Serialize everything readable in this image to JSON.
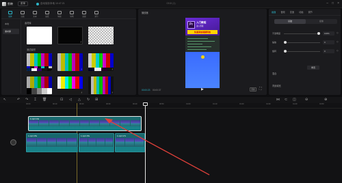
{
  "app": {
    "name": "剪映",
    "menu_label": "菜单",
    "autosave": "自动保存本地 10:47:21",
    "doc_title": "0315 (1)"
  },
  "toolbar": {
    "tools": [
      {
        "label": "媒体",
        "icon": "media-icon",
        "active": true
      },
      {
        "label": "音频",
        "icon": "audio-icon",
        "active": false
      },
      {
        "label": "文本",
        "icon": "text-icon",
        "active": false
      },
      {
        "label": "贴纸",
        "icon": "sticker-icon",
        "active": false
      },
      {
        "label": "特效",
        "icon": "effects-icon",
        "active": false
      },
      {
        "label": "转场",
        "icon": "transition-icon",
        "active": false
      },
      {
        "label": "滤镜",
        "icon": "filter-icon",
        "active": false
      },
      {
        "label": "调节",
        "icon": "adjust-icon",
        "active": false
      }
    ]
  },
  "media": {
    "nav": [
      "本地",
      "素材库"
    ],
    "section_basic": "素材库",
    "section_test": "测试素材"
  },
  "player": {
    "title": "播放器",
    "current_time": "00:00:23",
    "total_time": "00:00:37",
    "ratio_label": "原始",
    "content": {
      "logo_text": "Pr",
      "heading": "入门教程",
      "subheading": "进入剪辑",
      "banner": "快速添加视频特效"
    }
  },
  "inspector": {
    "tabs": [
      "画面",
      "音频",
      "变速",
      "动画",
      "调节"
    ],
    "segments": [
      "基础",
      "抠像"
    ],
    "props": [
      {
        "label": "不透明度",
        "value": "100%",
        "fraction": 1.0
      },
      {
        "label": "缩放",
        "value": "0",
        "fraction": 0.0
      },
      {
        "label": "旋转",
        "value": "0",
        "fraction": 0.0
      }
    ],
    "reset_label": "重置",
    "section_blend": "混合",
    "section_bg": "背景填充"
  },
  "timeline": {
    "ticks": [
      "00:00",
      "00:10",
      "00:20",
      "00:30",
      "00:40",
      "00:50",
      "01:00",
      "01:10",
      "01:20",
      "01:30",
      "01:40",
      "01:50"
    ],
    "clips": [
      {
        "label": "1.mp4  14s"
      },
      {
        "label": "1.mp4  15s"
      },
      {
        "label": "1.mp4  15s"
      },
      {
        "label": "1.mp4  17s"
      }
    ]
  },
  "colors": {
    "accent": "#2cb5c8",
    "clip": "#1a6a6f",
    "annotation_arrow": "#e0403a"
  }
}
